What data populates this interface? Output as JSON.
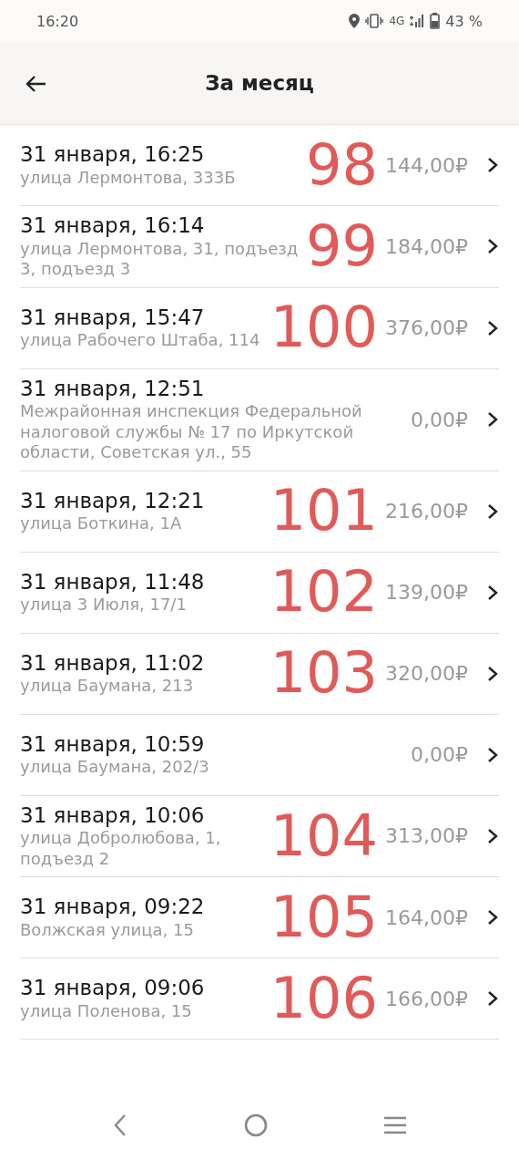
{
  "status_bar": {
    "time": "16:20",
    "network": "4G",
    "battery": "43 %"
  },
  "header": {
    "title": "За месяц"
  },
  "rows": [
    {
      "date": "31 января, 16:25",
      "address": "улица Лермонтова, 333Б",
      "amount": "144,00₽",
      "mark": "98"
    },
    {
      "date": "31 января, 16:14",
      "address": "улица Лермонтова, 31, подъезд 3, подъезд 3",
      "amount": "184,00₽",
      "mark": "99"
    },
    {
      "date": "31 января, 15:47",
      "address": "улица Рабочего Штаба, 114",
      "amount": "376,00₽",
      "mark": "100"
    },
    {
      "date": "31 января, 12:51",
      "address": "Межрайонная инспекция Федеральной налоговой службы № 17 по Иркутской области, Советская ул., 55",
      "amount": "0,00₽"
    },
    {
      "date": "31 января, 12:21",
      "address": "улица Боткина, 1А",
      "amount": "216,00₽",
      "mark": "101"
    },
    {
      "date": "31 января, 11:48",
      "address": "улица 3 Июля, 17/1",
      "amount": "139,00₽",
      "mark": "102"
    },
    {
      "date": "31 января, 11:02",
      "address": "улица Баумана, 213",
      "amount": "320,00₽",
      "mark": "103"
    },
    {
      "date": "31 января, 10:59",
      "address": "улица Баумана, 202/3",
      "amount": "0,00₽"
    },
    {
      "date": "31 января, 10:06",
      "address": "улица Добролюбова, 1, подъезд 2",
      "amount": "313,00₽",
      "mark": "104"
    },
    {
      "date": "31 января, 09:22",
      "address": "Волжская улица, 15",
      "amount": "164,00₽",
      "mark": "105"
    },
    {
      "date": "31 января, 09:06",
      "address": "улица Поленова, 15",
      "amount": "166,00₽",
      "mark": "106"
    }
  ]
}
